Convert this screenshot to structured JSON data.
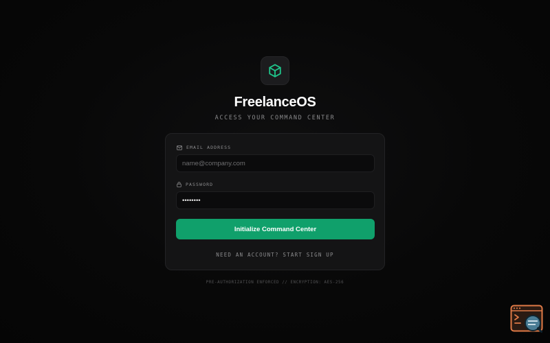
{
  "brand": {
    "logo_icon": "cube-icon",
    "title": "FreelanceOS",
    "tagline": "ACCESS YOUR COMMAND CENTER"
  },
  "form": {
    "email": {
      "icon": "mail-icon",
      "label": "EMAIL ADDRESS",
      "placeholder": "name@company.com",
      "value": ""
    },
    "password": {
      "icon": "lock-icon",
      "label": "PASSWORD",
      "value": "••••••••"
    },
    "submit_label": "Initialize Command Center",
    "signup_link": "NEED AN ACCOUNT? START SIGN UP"
  },
  "footer": {
    "note": "PRE-AUTHORIZATION ENFORCED // ENCRYPTION: AES-256"
  },
  "dev_widget": {
    "icon": "inspector-window-icon"
  },
  "colors": {
    "background": "#060606",
    "card": "#141415",
    "accent": "#10a06b",
    "logo_icon": "#1fc48a",
    "widget": "#e07a47"
  }
}
